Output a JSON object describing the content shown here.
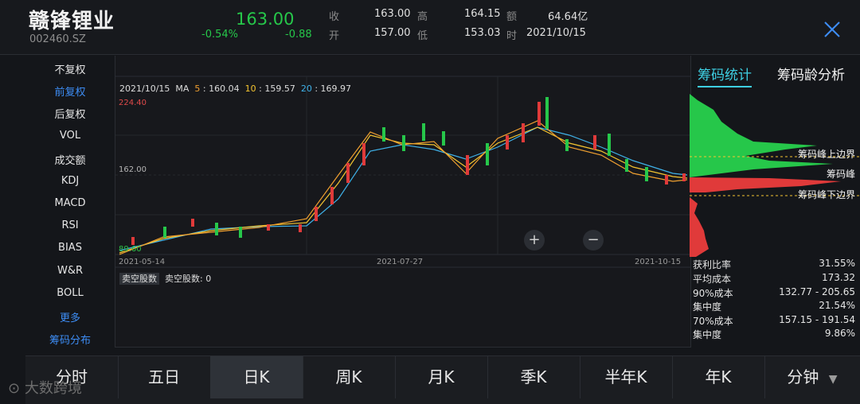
{
  "header": {
    "name": "赣锋锂业",
    "code": "002460.SZ",
    "price": "163.00",
    "change_pct": "-0.54%",
    "change": "-0.88",
    "quotes": [
      {
        "label": "收",
        "value": "163.00"
      },
      {
        "label": "高",
        "value": "164.15"
      },
      {
        "label": "额",
        "value": "64.64亿"
      },
      {
        "label": "开",
        "value": "157.00"
      },
      {
        "label": "低",
        "value": "153.03"
      },
      {
        "label": "时",
        "value": "2021/10/15"
      }
    ]
  },
  "left_menu": [
    "不复权",
    "前复权",
    "后复权",
    "VOL",
    "成交额",
    "KDJ",
    "MACD",
    "RSI",
    "BIAS",
    "W&R",
    "BOLL",
    "更多",
    "筹码分布"
  ],
  "chart": {
    "date": "2021/10/15",
    "ma_label": "MA",
    "ma5_label": "5",
    "ma5_value": "160.04",
    "ma10_label": "10",
    "ma10_value": "159.57",
    "ma20_label": "20",
    "ma20_value": "169.97",
    "ymax": "224.40",
    "ymid": "162.00",
    "ymin": "89.60",
    "date_start": "2021-05-14",
    "date_mid": "2021-07-27",
    "date_end": "2021-10-15",
    "vol_tag": "卖空股数",
    "vol_label": "卖空股数: 0",
    "zoom_in": "+",
    "zoom_out": "−"
  },
  "right_panel": {
    "tab_active": "筹码统计",
    "tab_other": "筹码龄分析",
    "peak_upper": "筹码峰上边界",
    "peak": "筹码峰",
    "peak_lower": "筹码峰下边界",
    "stats": [
      {
        "label": "获利比率",
        "value": "31.55%"
      },
      {
        "label": "平均成本",
        "value": "173.32"
      },
      {
        "label": "90%成本",
        "value": "132.77 - 205.65"
      },
      {
        "label": "集中度",
        "value": "21.54%"
      },
      {
        "label": "70%成本",
        "value": "157.15 - 191.54"
      },
      {
        "label": "集中度",
        "value": "9.86%"
      }
    ]
  },
  "periods": [
    "分时",
    "五日",
    "日K",
    "周K",
    "月K",
    "季K",
    "半年K",
    "年K",
    "分钟"
  ],
  "watermark": "大数跨境",
  "colors": {
    "up": "#e03a3a",
    "down": "#26c74a",
    "ma5": "#f0a030",
    "ma10": "#f4c430",
    "ma20": "#3fb1e8",
    "accent": "#3ecfe2"
  }
}
